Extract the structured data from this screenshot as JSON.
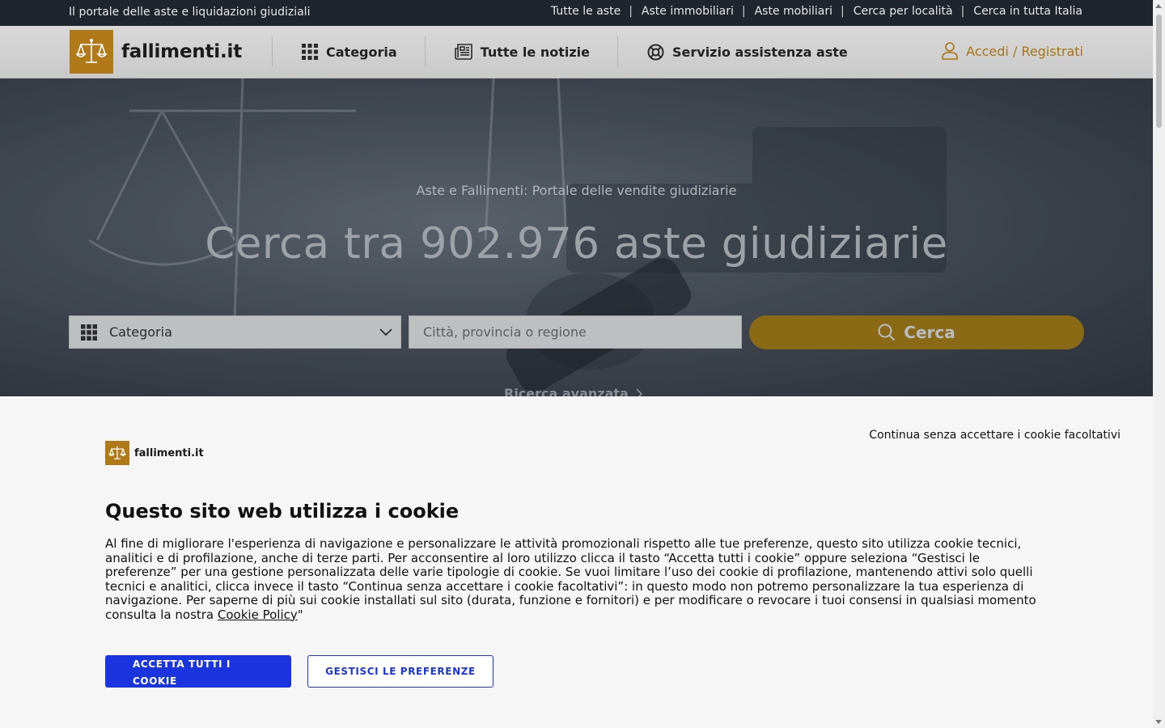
{
  "topbar": {
    "tagline": "Il portale delle aste e liquidazioni giudiziali",
    "links": [
      "Tutte le aste",
      "Aste immobiliari",
      "Aste mobiliari",
      "Cerca per località",
      "Cerca in tutta Italia"
    ]
  },
  "header": {
    "logo_text": "fallimenti.it",
    "nav": [
      {
        "label": "Categoria",
        "icon": "grid-icon"
      },
      {
        "label": "Tutte le notizie",
        "icon": "newspaper-icon"
      },
      {
        "label": "Servizio assistenza aste",
        "icon": "lifebuoy-icon"
      }
    ],
    "login_label": "Accedi / Registrati"
  },
  "hero": {
    "subtitle": "Aste e Fallimenti: Portale delle vendite giudiziarie",
    "title": "Cerca tra 902.976 aste giudiziarie",
    "category_label": "Categoria",
    "city_placeholder": "Città, provincia o regione",
    "search_label": "Cerca",
    "advanced_label": "Ricerca avanzata"
  },
  "cookie": {
    "skip_label": "Continua senza accettare i cookie facoltativi",
    "logo_text": "fallimenti.it",
    "title": "Questo sito web utilizza i cookie",
    "text": "Al fine di migliorare l'esperienza di navigazione e personalizzare le attività promozionali rispetto alle tue preferenze, questo sito utilizza cookie tecnici, analitici e di profilazione, anche di terze parti. Per acconsentire al loro utilizzo clicca il tasto “Accetta tutti i cookie” oppure seleziona “Gestisci le preferenze” per una gestione personalizzata delle varie tipologie di cookie. Se vuoi limitare l’uso dei cookie di profilazione, mantenendo attivi solo quelli tecnici e analitici, clicca invece il tasto “Continua senza accettare i cookie facoltativi”: in questo modo non potremo personalizzare la tua esperienza di navigazione. Per saperne di più sui cookie installati sul sito (durata, funzione e fornitori) e per modificare o revocare i tuoi consensi in qualsiasi momento consulta la nostra ",
    "policy_link": "Cookie Policy",
    "text_end": "\"",
    "accept_label": "ACCETTA TUTTI I COOKIE",
    "prefs_label": "GESTISCI LE PREFERENZE"
  },
  "colors": {
    "brand_gold": "#b07a18",
    "accept_blue": "#1a35e0",
    "topbar_bg": "#1f252c"
  }
}
